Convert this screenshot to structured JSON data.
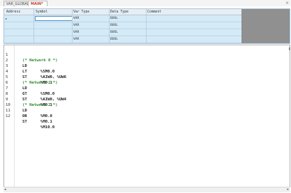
{
  "tabs": [
    {
      "label": "VAR_GLOBAL"
    },
    {
      "label": "MAIN*"
    }
  ],
  "close_glyph": "×",
  "var_table": {
    "columns": [
      "Address",
      "Symbol",
      "Var Type",
      "Data Type",
      "Comment"
    ],
    "current_row_marker": "▸",
    "rows": [
      {
        "address": "",
        "symbol": "",
        "var_type": "VAR",
        "data_type": "BOOL",
        "comment": ""
      },
      {
        "address": "",
        "symbol": "",
        "var_type": "VAR",
        "data_type": "BOOL",
        "comment": ""
      },
      {
        "address": "",
        "symbol": "",
        "var_type": "VAR",
        "data_type": "BOOL",
        "comment": ""
      },
      {
        "address": "",
        "symbol": "",
        "var_type": "VAR",
        "data_type": "BOOL",
        "comment": ""
      }
    ]
  },
  "editor": {
    "lines": [
      {
        "num": "1",
        "kind": "comment",
        "text": "(* Network 0 *)"
      },
      {
        "num": "2",
        "kind": "code",
        "op": "LD",
        "arg": "%SM0.0"
      },
      {
        "num": "3",
        "kind": "code",
        "op": "LT",
        "arg": "%AIW0, %UW6"
      },
      {
        "num": "4",
        "kind": "code",
        "op": "ST",
        "arg": "%M0.1"
      },
      {
        "num": "5",
        "kind": "comment",
        "text": "(* Network 1 *)"
      },
      {
        "num": "6",
        "kind": "code",
        "op": "LD",
        "arg": "%SM0.0"
      },
      {
        "num": "7",
        "kind": "code",
        "op": "GT",
        "arg": "%AIW0, %UW4"
      },
      {
        "num": "8",
        "kind": "code",
        "op": "ST",
        "arg": "%M0.1"
      },
      {
        "num": "9",
        "kind": "comment",
        "text": "(* Network 2 *)"
      },
      {
        "num": "10",
        "kind": "code",
        "op": "LD",
        "arg": "%M0.0"
      },
      {
        "num": "11",
        "kind": "code",
        "op": "OR",
        "arg": "%M0.1"
      },
      {
        "num": "12",
        "kind": "code",
        "op": "ST",
        "arg": "%M10.0"
      }
    ]
  },
  "scrollbar": {
    "left_arrow": "◂",
    "right_arrow": "▸"
  }
}
